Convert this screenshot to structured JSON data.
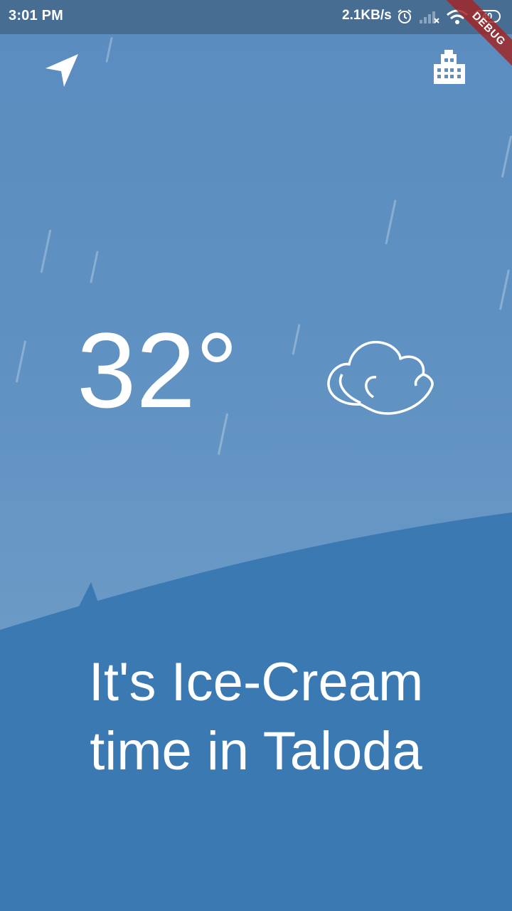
{
  "status_bar": {
    "time": "3:01 PM",
    "network_speed": "2.1KB/s",
    "battery_level": "40",
    "icons": [
      "alarm-icon",
      "signal-icon",
      "wifi-icon",
      "battery-icon"
    ]
  },
  "debug_banner": {
    "label": "DEBUG"
  },
  "toolbar": {
    "location_icon": "navigation-arrow-icon",
    "city_icon": "city-buildings-icon"
  },
  "weather": {
    "temperature": "32°",
    "condition_icon": "cloud-icon"
  },
  "message": {
    "line1": "It's Ice-Cream",
    "line2": "time in Taloda"
  },
  "colors": {
    "sky": "#5f91c2",
    "hill": "#3b79b2",
    "status_bar": "#476d93",
    "debug": "#a02828",
    "text": "#ffffff"
  }
}
